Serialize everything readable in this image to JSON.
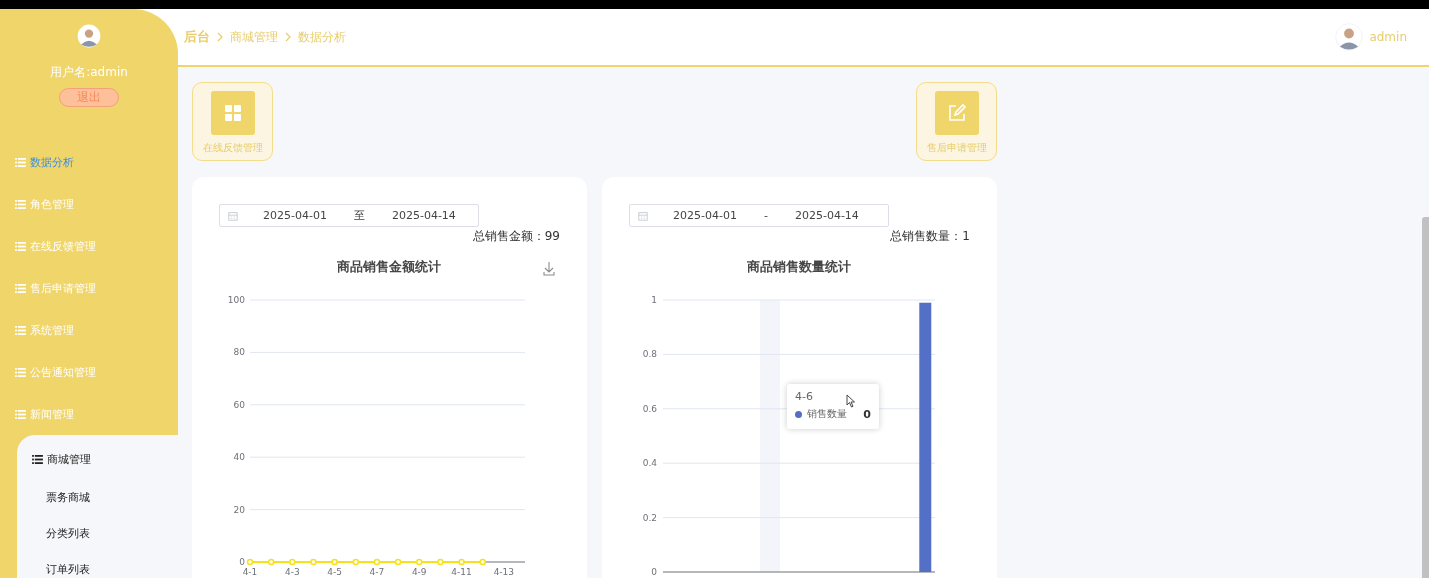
{
  "sidebar": {
    "username": "用户名:admin",
    "logout": "退出",
    "menu": [
      {
        "label": "数据分析",
        "selected": true
      },
      {
        "label": "角色管理",
        "selected": false
      },
      {
        "label": "在线反馈管理",
        "selected": false
      },
      {
        "label": "售后申请管理",
        "selected": false
      },
      {
        "label": "系统管理",
        "selected": false
      },
      {
        "label": "公告通知管理",
        "selected": false
      },
      {
        "label": "新闻管理",
        "selected": false
      },
      {
        "label": "商城管理",
        "selected": false,
        "expanded": true,
        "children": [
          {
            "label": "票务商城"
          },
          {
            "label": "分类列表"
          },
          {
            "label": "订单列表"
          }
        ]
      }
    ]
  },
  "header": {
    "breadcrumb": [
      "后台",
      "商城管理",
      "数据分析"
    ],
    "user": "admin"
  },
  "shortcuts": [
    {
      "label": "在线反馈管理",
      "kind": "grid"
    },
    {
      "label": "售后申请管理",
      "kind": "edit"
    }
  ],
  "panels": [
    {
      "date_range": {
        "start": "2025-04-01",
        "separator": "至",
        "end": "2025-04-14"
      },
      "total": "总销售金额：99",
      "download_button": true,
      "chart_data": {
        "type": "line",
        "title": "商品销售金额统计",
        "categories": [
          "4-1",
          null,
          "4-3",
          null,
          "4-5",
          null,
          "4-7",
          null,
          "4-9",
          null,
          "4-11",
          null,
          "4-13",
          null
        ],
        "series": [
          {
            "color": "#f7e11a",
            "marker": true,
            "values": [
              0,
              0,
              0,
              0,
              0,
              0,
              0,
              0,
              0,
              0,
              0,
              0,
              null,
              null
            ]
          }
        ],
        "ylim": [
          0,
          100
        ],
        "yticks": [
          0,
          20,
          40,
          60,
          80,
          100
        ],
        "grid": true
      }
    },
    {
      "date_range": {
        "start": "2025-04-01",
        "separator": "-",
        "end": "2025-04-14"
      },
      "total": "总销售数量：1",
      "chart_data": {
        "type": "bar",
        "title": "商品销售数量统计",
        "series": [
          {
            "name": "销售数量",
            "color": "#5470c6",
            "values": [
              0,
              0,
              0,
              0,
              0,
              0,
              0,
              0,
              0,
              0,
              0,
              0,
              0,
              0.99
            ]
          }
        ],
        "ylim": [
          0,
          1
        ],
        "yticks": [
          0,
          0.2,
          0.4,
          0.6,
          0.8,
          1
        ],
        "grid": true
      },
      "tooltip": {
        "category": "4-6",
        "value": "0"
      }
    }
  ]
}
